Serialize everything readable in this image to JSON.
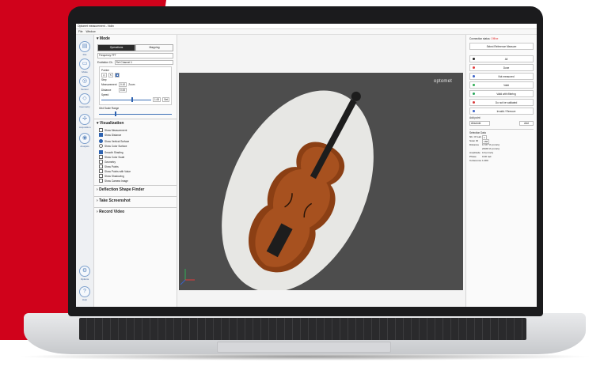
{
  "app": {
    "window_title": "Optomet measurement - Violin",
    "menu": [
      "File",
      "Window"
    ]
  },
  "iconbar": [
    {
      "label": "File",
      "icon": "folder-icon"
    },
    {
      "label": "Mode",
      "icon": "mode-icon"
    },
    {
      "label": "Sensor",
      "icon": "sensor-icon"
    },
    {
      "label": "Geometry",
      "icon": "geometry-icon"
    },
    {
      "label": "Acquisition",
      "icon": "acquisition-icon"
    },
    {
      "label": "Analysis",
      "icon": "analysis-icon"
    },
    {
      "label": "Options",
      "icon": "gear-icon"
    },
    {
      "label": "Help",
      "icon": "help-icon"
    }
  ],
  "mode": {
    "title": "Mode",
    "tabs": [
      "Operations",
      "Mapping"
    ],
    "preset": "Frequency FFT",
    "excitation_label": "Excitation Ch.",
    "excitation_value": "Ref Channel 1",
    "pointer_label": "Pointer",
    "step_label": "Step",
    "measurement_label": "Measurement",
    "measurement_value": "0.10",
    "distance_label": "Distance",
    "distance_value": "0.00",
    "speed_label": "Speed",
    "speed_value": "1.00",
    "ok_label": "Set",
    "zoom_label": "Zoom",
    "scale_range_label": "Grid Scale Range"
  },
  "visualization": {
    "title": "Visualization",
    "options": [
      {
        "label": "Show Measurement",
        "checked": false
      },
      {
        "label": "Show Distance",
        "checked": true
      }
    ],
    "radios": [
      {
        "label": "Show Vertical Surface",
        "checked": true
      },
      {
        "label": "Show Color Surface",
        "checked": false
      }
    ],
    "layers": [
      {
        "label": "Smooth Shading",
        "checked": true
      },
      {
        "label": "Show Color Scale",
        "checked": false
      },
      {
        "label": "Geometry",
        "checked": false
      },
      {
        "label": "Show Points",
        "checked": false
      },
      {
        "label": "Show Points with Value",
        "checked": false
      },
      {
        "label": "Show Shadowing",
        "checked": false
      },
      {
        "label": "Show Camera Image",
        "checked": false
      }
    ]
  },
  "sections": [
    "Deflection Shape Finder",
    "Take Screenshot",
    "Record Video"
  ],
  "viewport": {
    "brand": "optomet",
    "bg_color": "#4d4d4d"
  },
  "right": {
    "connection_label": "Connection status:",
    "connection_value": "Offline",
    "select_button": "Select Reference Measure",
    "buttons": [
      {
        "label": "All",
        "color": "#222222"
      },
      {
        "label": "Done",
        "color": "#e23b3b"
      },
      {
        "label": "Not measured",
        "color": "#3b62c7"
      },
      {
        "label": "Valid",
        "color": "#2fae55"
      },
      {
        "label": "Valid with filtering",
        "color": "#26a55a"
      },
      {
        "label": "Do not be validated",
        "color": "#d93a3a"
      },
      {
        "label": "Invalid / Remove",
        "color": "#3b62c7"
      }
    ],
    "add_point_label": "Add point",
    "add_point_select": "Absolute",
    "add_button": "Add",
    "selection_title": "Selection Data",
    "kv": [
      {
        "k": "Nb. Of Lab",
        "v": "1"
      },
      {
        "k": "Scan ID",
        "v": "188"
      },
      {
        "k": "Distance",
        "v": "17.87 % (mm/s)"
      },
      {
        "k": "",
        "v": "28.86 % (mm/s)"
      },
      {
        "k": "Amplitude",
        "v": "10 (mm/s)"
      },
      {
        "k": "Phase",
        "v": "0.00 rad"
      },
      {
        "k": "Coherence",
        "v": "1.000"
      }
    ]
  }
}
